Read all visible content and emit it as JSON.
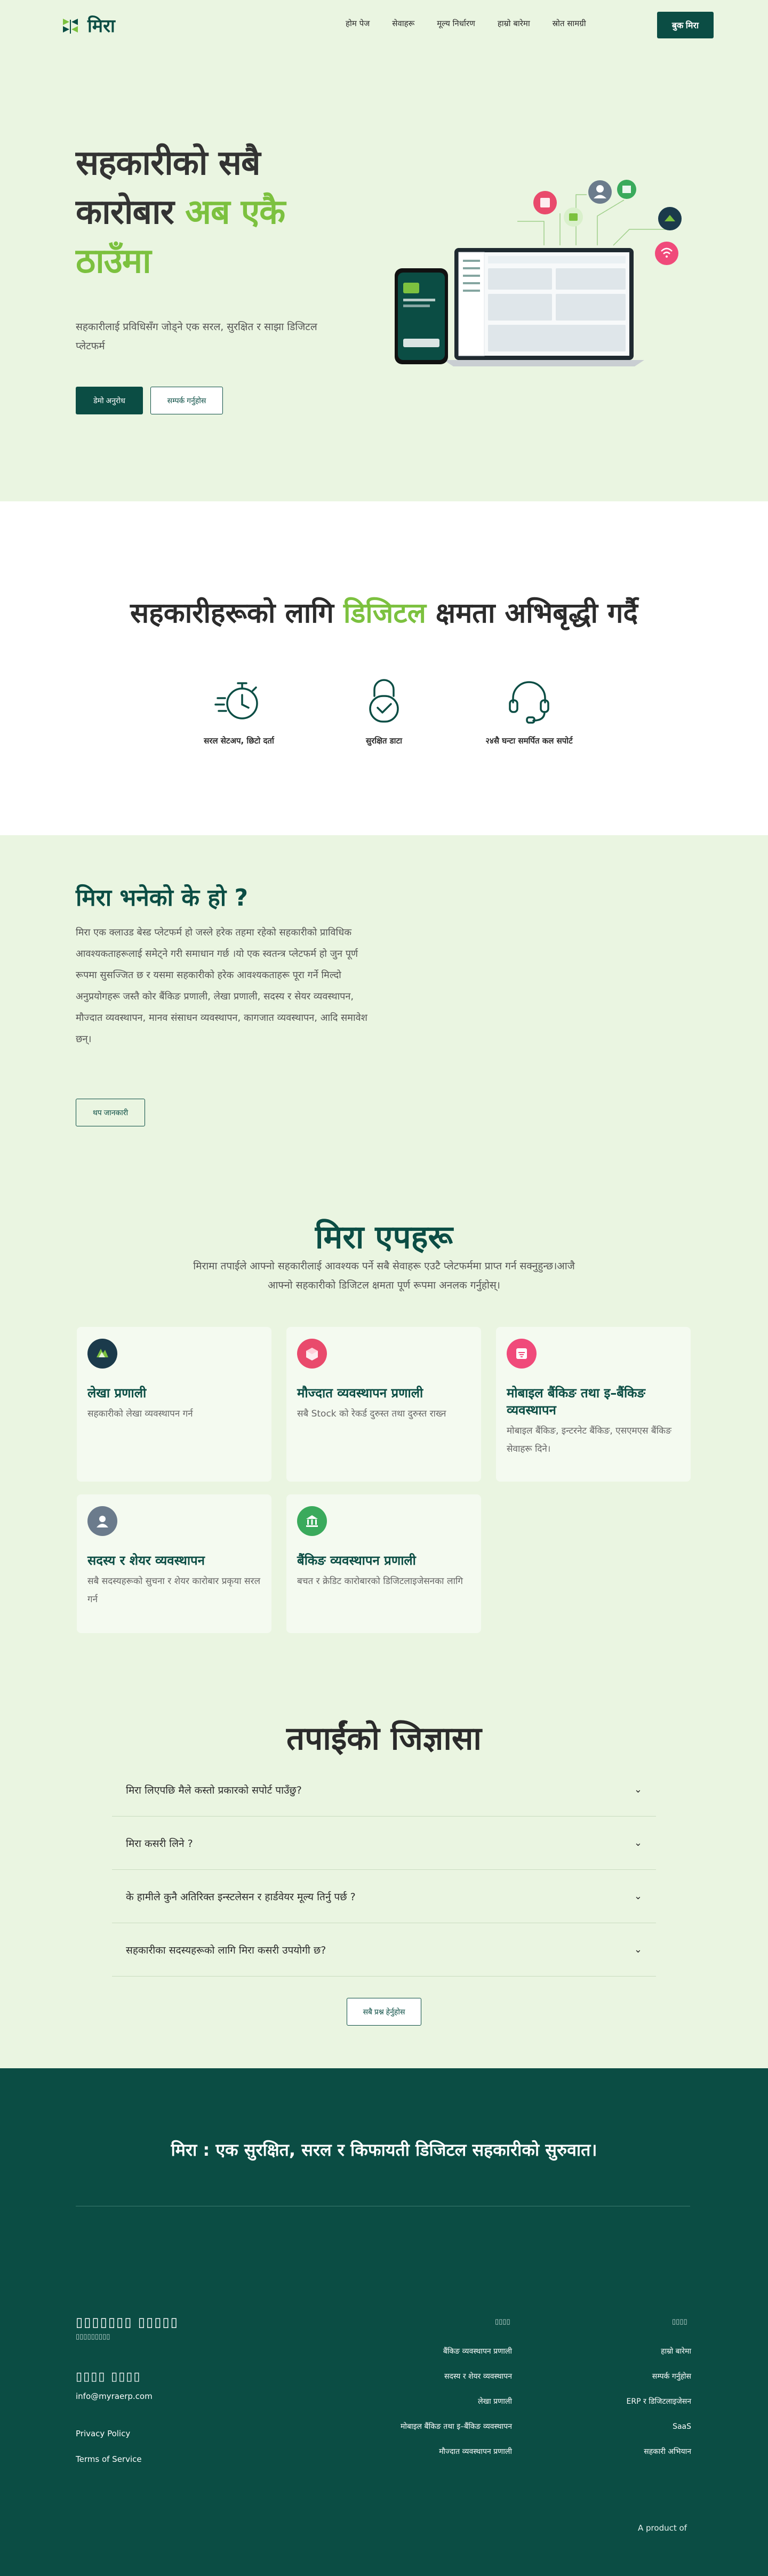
{
  "nav": {
    "brand": "मिरा",
    "links": [
      "होम पेज",
      "सेवाहरू",
      "मूल्य निर्धारण",
      "हाम्रो बारेमा",
      "स्रोत सामग्री"
    ],
    "cta": "बुक मिरा"
  },
  "hero": {
    "title_line1": "सहकारीको सबै",
    "title_line2a": "कारोबार ",
    "title_line2b": "अब एकै",
    "title_line3": "ठाउँमा",
    "subtitle": "सहकारीलाई प्रविधिसँग जोड्ने एक सरल, सुरक्षित र साझा डिजिटल प्लेटफर्म",
    "btn_primary": "डेमो अनुरोध",
    "btn_secondary": "सम्पर्क गर्नुहोस"
  },
  "digital": {
    "title_a": "सहकारीहरूको लागि ",
    "title_b": "डिजिटल",
    "title_c": " क्षमता अभिबृद्धी गर्दै",
    "features": [
      {
        "icon": "stopwatch-icon",
        "label": "सरल सेटअप, छिटो दर्ता"
      },
      {
        "icon": "padlock-icon",
        "label": "सुरक्षित डाटा"
      },
      {
        "icon": "headset-icon",
        "label": "२४सै घन्टा समर्पित कल सपोर्ट"
      }
    ]
  },
  "whatis": {
    "title": "मिरा भनेको के हो ?",
    "text": "मिरा एक क्लाउड बेस्ड प्लेटफर्म हो जस्ले हरेक तहमा रहेको सहकारीको प्राविधिक आवश्यकताहरूलाई समेट्ने गरी समाधान गर्छ ।यो एक स्वतन्त्र प्लेटफर्म हो जुन पूर्ण रूपमा सुसज्जित छ र यसमा सहकारीको हरेक आवश्यकताहरू पूरा गर्ने मिल्दो अनुप्रयोगहरू जस्तै कोर बैंकिङ प्रणाली, लेखा प्रणाली, सदस्य र सेयर व्यवस्थापन, मौज्दात व्यवस्थापन, मानव संसाधन व्यवस्थापन, कागजात व्यवस्थापन, आदि समावेश छन्।",
    "button": "थप जानकारी"
  },
  "apps": {
    "title": "मिरा एपहरू",
    "subtitle": "मिरामा तपाईले आफ्नो सहकारीलाई आवश्यक पर्ने सबै सेवाहरू एउटै प्लेटफर्ममा प्राप्त गर्न सक्नुहुन्छ।आजै आफ्नो सहकारीको डिजिटल क्षमता पूर्ण रूपमा अनलक गर्नुहोस्।",
    "cards": [
      {
        "icon": "ledger-icon",
        "name": "लेखा प्रणाली",
        "desc": "सहकारीको लेखा व्यवस्थापन गर्न"
      },
      {
        "icon": "cube-icon",
        "name": "मौज्दात व्यवस्थापन प्रणाली",
        "desc": "सबै Stock को रेकर्ड दुरुस्त तथा दुरुस्त राख्न"
      },
      {
        "icon": "mobile-banking-icon",
        "name": "मोबाइल बैंकिङ तथा इ–बैंकिङ व्यवस्थापन",
        "desc": "मोबाइल बैंकिङ, इन्टरनेट बैंकिङ, एसएमएस बैंकिङ सेवाहरू दिने।"
      },
      {
        "icon": "user-icon",
        "name": "सदस्य र शेयर व्यवस्थापन",
        "desc": "सबै सदस्यहरूको सुचना र शेयर कारोबार प्रकृया सरल गर्न"
      },
      {
        "icon": "bank-icon",
        "name": "बैंकिङ व्यवस्थापन प्रणाली",
        "desc": "बचत र क्रेडिट कारोबारको डिजिटलाइजेसनका लागि"
      }
    ],
    "colors": {
      "ledger": "#1b3a4b",
      "cube": "#e94a6c",
      "mobile": "#f04a7a",
      "user": "#6b7b8c",
      "bank": "#3aaa5c"
    }
  },
  "faq": {
    "title": "तपाईंको जिज्ञासा",
    "items": [
      "मिरा लिएपछि मैले कस्तो प्रकारको सपोर्ट पाउँछु?",
      "मिरा कसरी लिने ?",
      "के हामीले कुनै अतिरिक्त इन्स्टलेसन र हार्डवेयर मूल्य तिर्नु पर्छ ?",
      "सहकारीका सदस्यहरूको लागि मिरा कसरी उपयोगी छ?"
    ],
    "button": "सबै प्रश्न हेर्नुहोस"
  },
  "footer": {
    "tagline": "मिरा : एक सुरक्षित, सरल र किफायती डिजिटल सहकारीको सुरुवात।",
    "brand_name": "▯▯▯▯▯▯▯ ▯▯▯▯▯",
    "brand_sub": "▯▯▯▯▯▯▯▯▯",
    "contact_heading": "▯▯▯▯ ▯▯▯▯",
    "email": "info@myraerp.com",
    "privacy": "Privacy Policy",
    "terms": "Terms of Service",
    "col1_heading": "▯▯▯▯",
    "col1": [
      "बैंकिङ व्यवस्थापन प्रणाली",
      "सदस्य र शेयर व्यवस्थापन",
      "लेखा प्रणाली",
      "मोबाइल बैंकिङ तथा इ–बैंकिङ व्यवस्थापन",
      "मौज्दात व्यवस्थापन प्रणाली"
    ],
    "col2_heading": "▯▯▯▯",
    "col2": [
      "हाम्रो बारेमा",
      "सम्पर्क गर्नुहोस",
      "ERP र डिजिटलाइजेसन",
      "SaaS",
      "सहकारी अभियान"
    ],
    "product": "A product of"
  },
  "colors": {
    "brand": "#0b4d44",
    "accent": "#7cc13f",
    "background": "#eaf5e1"
  }
}
